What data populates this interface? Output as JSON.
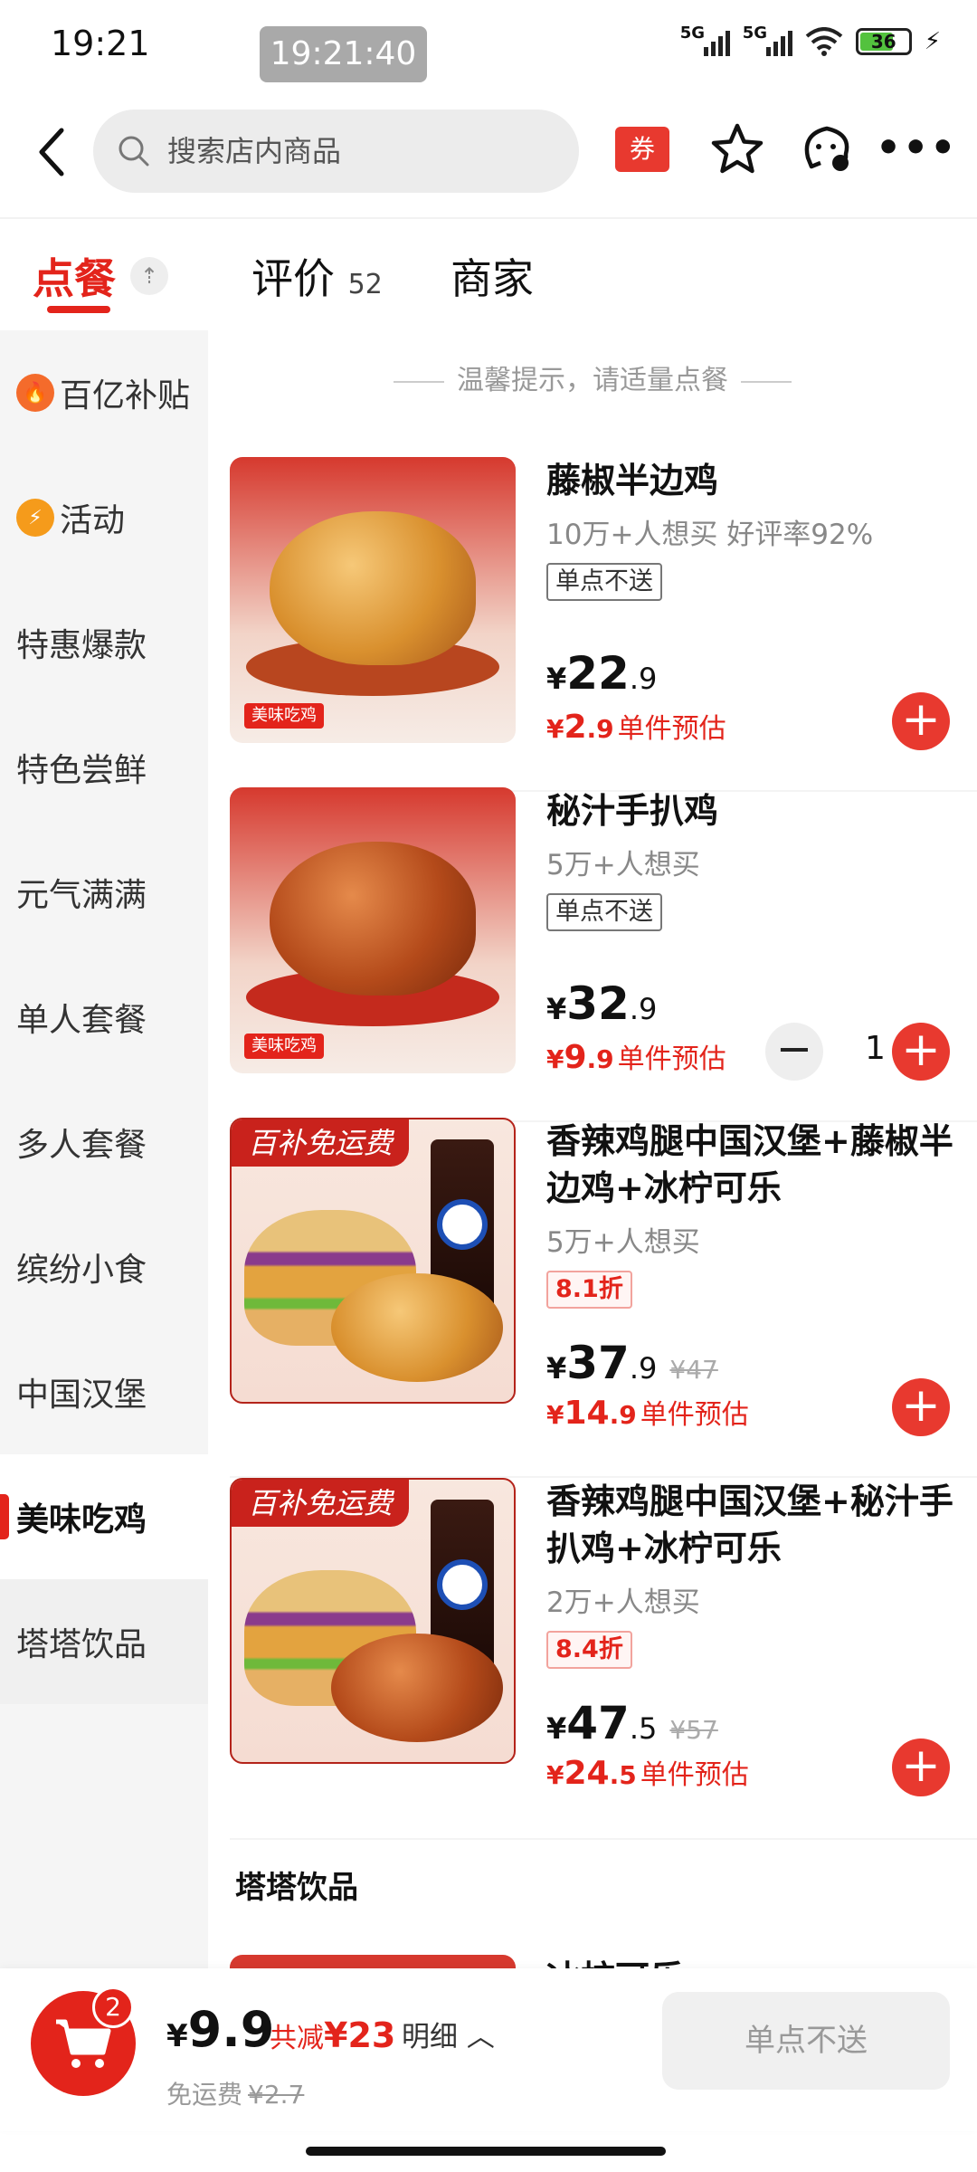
{
  "status_bar": {
    "time": "19:21",
    "clock_pill": "19:21:40",
    "sig1": "5G",
    "sig2": "5G",
    "battery": "36"
  },
  "nav": {
    "search_placeholder": "搜索店内商品",
    "coupon": "券"
  },
  "tabs": [
    {
      "label": "点餐"
    },
    {
      "label": "评价",
      "count": "52"
    },
    {
      "label": "商家"
    }
  ],
  "sidebar": {
    "items": [
      {
        "label": "百亿补贴",
        "icon": "fire-icon"
      },
      {
        "label": "活动",
        "icon": "activity-icon"
      },
      {
        "label": "特惠爆款"
      },
      {
        "label": "特色尝鲜"
      },
      {
        "label": "元气满满"
      },
      {
        "label": "单人套餐"
      },
      {
        "label": "多人套餐"
      },
      {
        "label": "缤纷小食"
      },
      {
        "label": "中国汉堡"
      },
      {
        "label": "美味吃鸡"
      },
      {
        "label": "塔塔饮品"
      }
    ]
  },
  "content": {
    "tip": "温馨提示，请适量点餐",
    "products": [
      {
        "name": "藤椒半边鸡",
        "sub": "10万+人想买 好评率92%",
        "tag": "单点不送",
        "price_int": "22",
        "price_dec": ".9",
        "est_int": "2",
        "est_dec": ".9",
        "est_label": "单件预估",
        "img_label": "美味吃鸡"
      },
      {
        "name": "秘汁手扒鸡",
        "sub": "5万+人想买",
        "tag": "单点不送",
        "price_int": "32",
        "price_dec": ".9",
        "est_int": "9",
        "est_dec": ".9",
        "est_label": "单件预估",
        "qty": "1",
        "img_label": "美味吃鸡"
      },
      {
        "name": "香辣鸡腿中国汉堡+藤椒半边鸡+冰柠可乐",
        "sub": "5万+人想买",
        "tag": "8.1折",
        "price_int": "37",
        "price_dec": ".9",
        "old_price": "¥47",
        "est_int": "14",
        "est_dec": ".9",
        "est_label": "单件预估",
        "ribbon": "百补免运费",
        "cup_label": "百事可乐"
      },
      {
        "name": "香辣鸡腿中国汉堡+秘汁手扒鸡+冰柠可乐",
        "sub": "2万+人想买",
        "tag": "8.4折",
        "price_int": "47",
        "price_dec": ".5",
        "old_price": "¥57",
        "est_int": "24",
        "est_dec": ".5",
        "est_label": "单件预估",
        "ribbon": "百补免运费",
        "cup_label": "百事可乐"
      }
    ],
    "section_title": "塔塔饮品",
    "peek_name": "冰柠可乐"
  },
  "cart": {
    "count": "2",
    "currency": "¥",
    "total": "9.9",
    "save_label": "共减",
    "save_amount": "¥23",
    "detail": "明细",
    "fee_label": "免运费",
    "fee_old": "¥2.7",
    "checkout": "单点不送"
  },
  "colors": {
    "accent": "#e3241b",
    "sidebar_bg": "#f5f5f5"
  }
}
